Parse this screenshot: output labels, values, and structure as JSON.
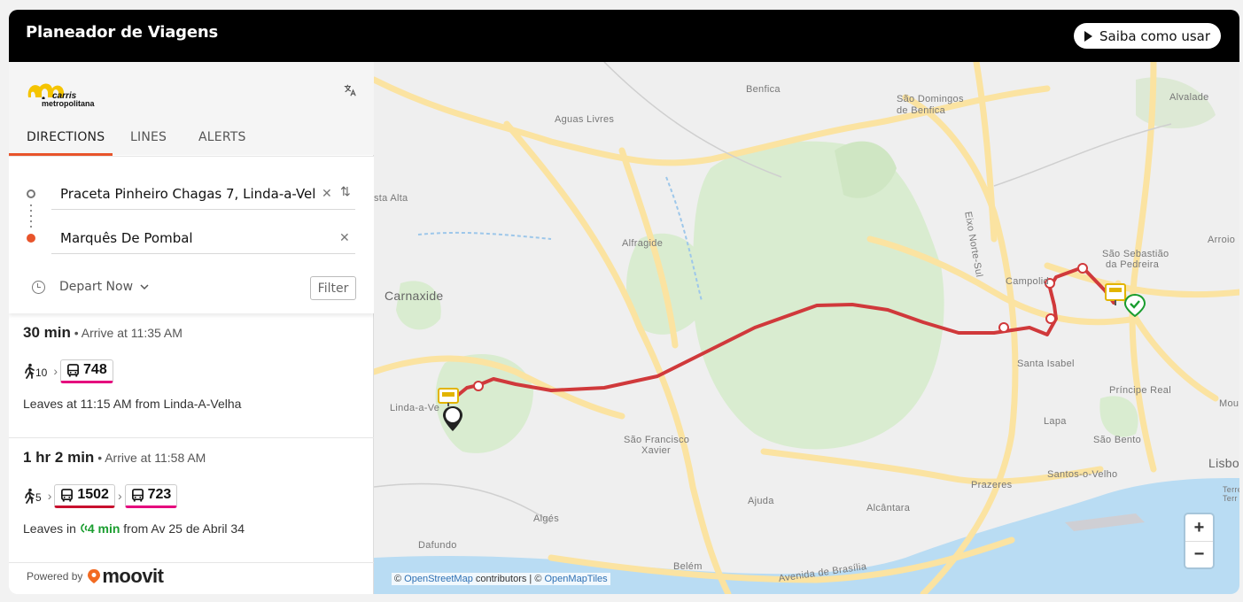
{
  "header": {
    "title": "Planeador de Viagens",
    "how_to_label": "Saiba como usar"
  },
  "brand": {
    "logo_line1": "carris",
    "logo_line2": "metropolitana",
    "translate_icon": "translate-icon"
  },
  "tabs": [
    {
      "label": "DIRECTIONS",
      "active": true
    },
    {
      "label": "LINES",
      "active": false
    },
    {
      "label": "ALERTS",
      "active": false
    }
  ],
  "planner": {
    "origin": "Praceta Pinheiro Chagas 7, Linda-a-Vel ...",
    "destination": "Marquês De Pombal",
    "depart_label": "Depart Now",
    "filter_label": "Filter"
  },
  "results": [
    {
      "duration": "30 min",
      "arrive": "• Arrive at 11:35 AM",
      "walk_minutes": "10",
      "lines": [
        {
          "number": "748",
          "color": "#e5007d"
        }
      ],
      "leaves_prefix": "Leaves at 11:15 AM from Linda-A-Velha",
      "live": "",
      "leaves_suffix": ""
    },
    {
      "duration": "1 hr 2 min",
      "arrive": "• Arrive at 11:58 AM",
      "walk_minutes": "5",
      "lines": [
        {
          "number": "1502",
          "color": "#c8102e"
        },
        {
          "number": "723",
          "color": "#e5007d"
        }
      ],
      "leaves_prefix": "Leaves in ",
      "live": "4 min",
      "leaves_suffix": " from Av 25 de Abril 34"
    }
  ],
  "powered": {
    "label": "Powered by",
    "brand": "moovit"
  },
  "map": {
    "places": {
      "benfica": "Benfica",
      "sao_domingos_1": "São Domingos",
      "sao_domingos_2": "de Benfica",
      "aguas_livres": "Aguas Livres",
      "alvalade": "Alvalade",
      "sta_alta": "sta Alta",
      "eixo": "Eixo Norte-Sul",
      "alfragide": "Alfragide",
      "arroios": "Arroio",
      "sao_sebastiao_1": "São Sebastião",
      "sao_sebastiao_2": "da Pedreira",
      "campolide": "Campolid",
      "carnaxide": "Carnaxide",
      "santa_isabel": "Santa Isabel",
      "principe_real": "Príncipe Real",
      "linda_a_velha": "Linda-a-Ve",
      "mou": "Mou",
      "lapa": "Lapa",
      "sao_francisco_1": "São Francisco",
      "sao_francisco_2": "Xavier",
      "sao_bento": "São Bento",
      "lisboa": "Lisbo",
      "prazeres": "Prazeres",
      "santos": "Santos-o-Velho",
      "terre": "Terre",
      "terr": "Terr",
      "ajuda": "Ajuda",
      "alcantara": "Alcântara",
      "alges": "Algés",
      "dafundo": "Dafundo",
      "belem": "Belém",
      "brasilia": "Avenida de Brasília"
    },
    "attribution_osm": "OpenStreetMap",
    "attribution_mid": " contributors | © ",
    "attribution_tiles": "OpenMapTiles",
    "route_color": "#d0393b",
    "zoom_in": "+",
    "zoom_out": "−"
  }
}
